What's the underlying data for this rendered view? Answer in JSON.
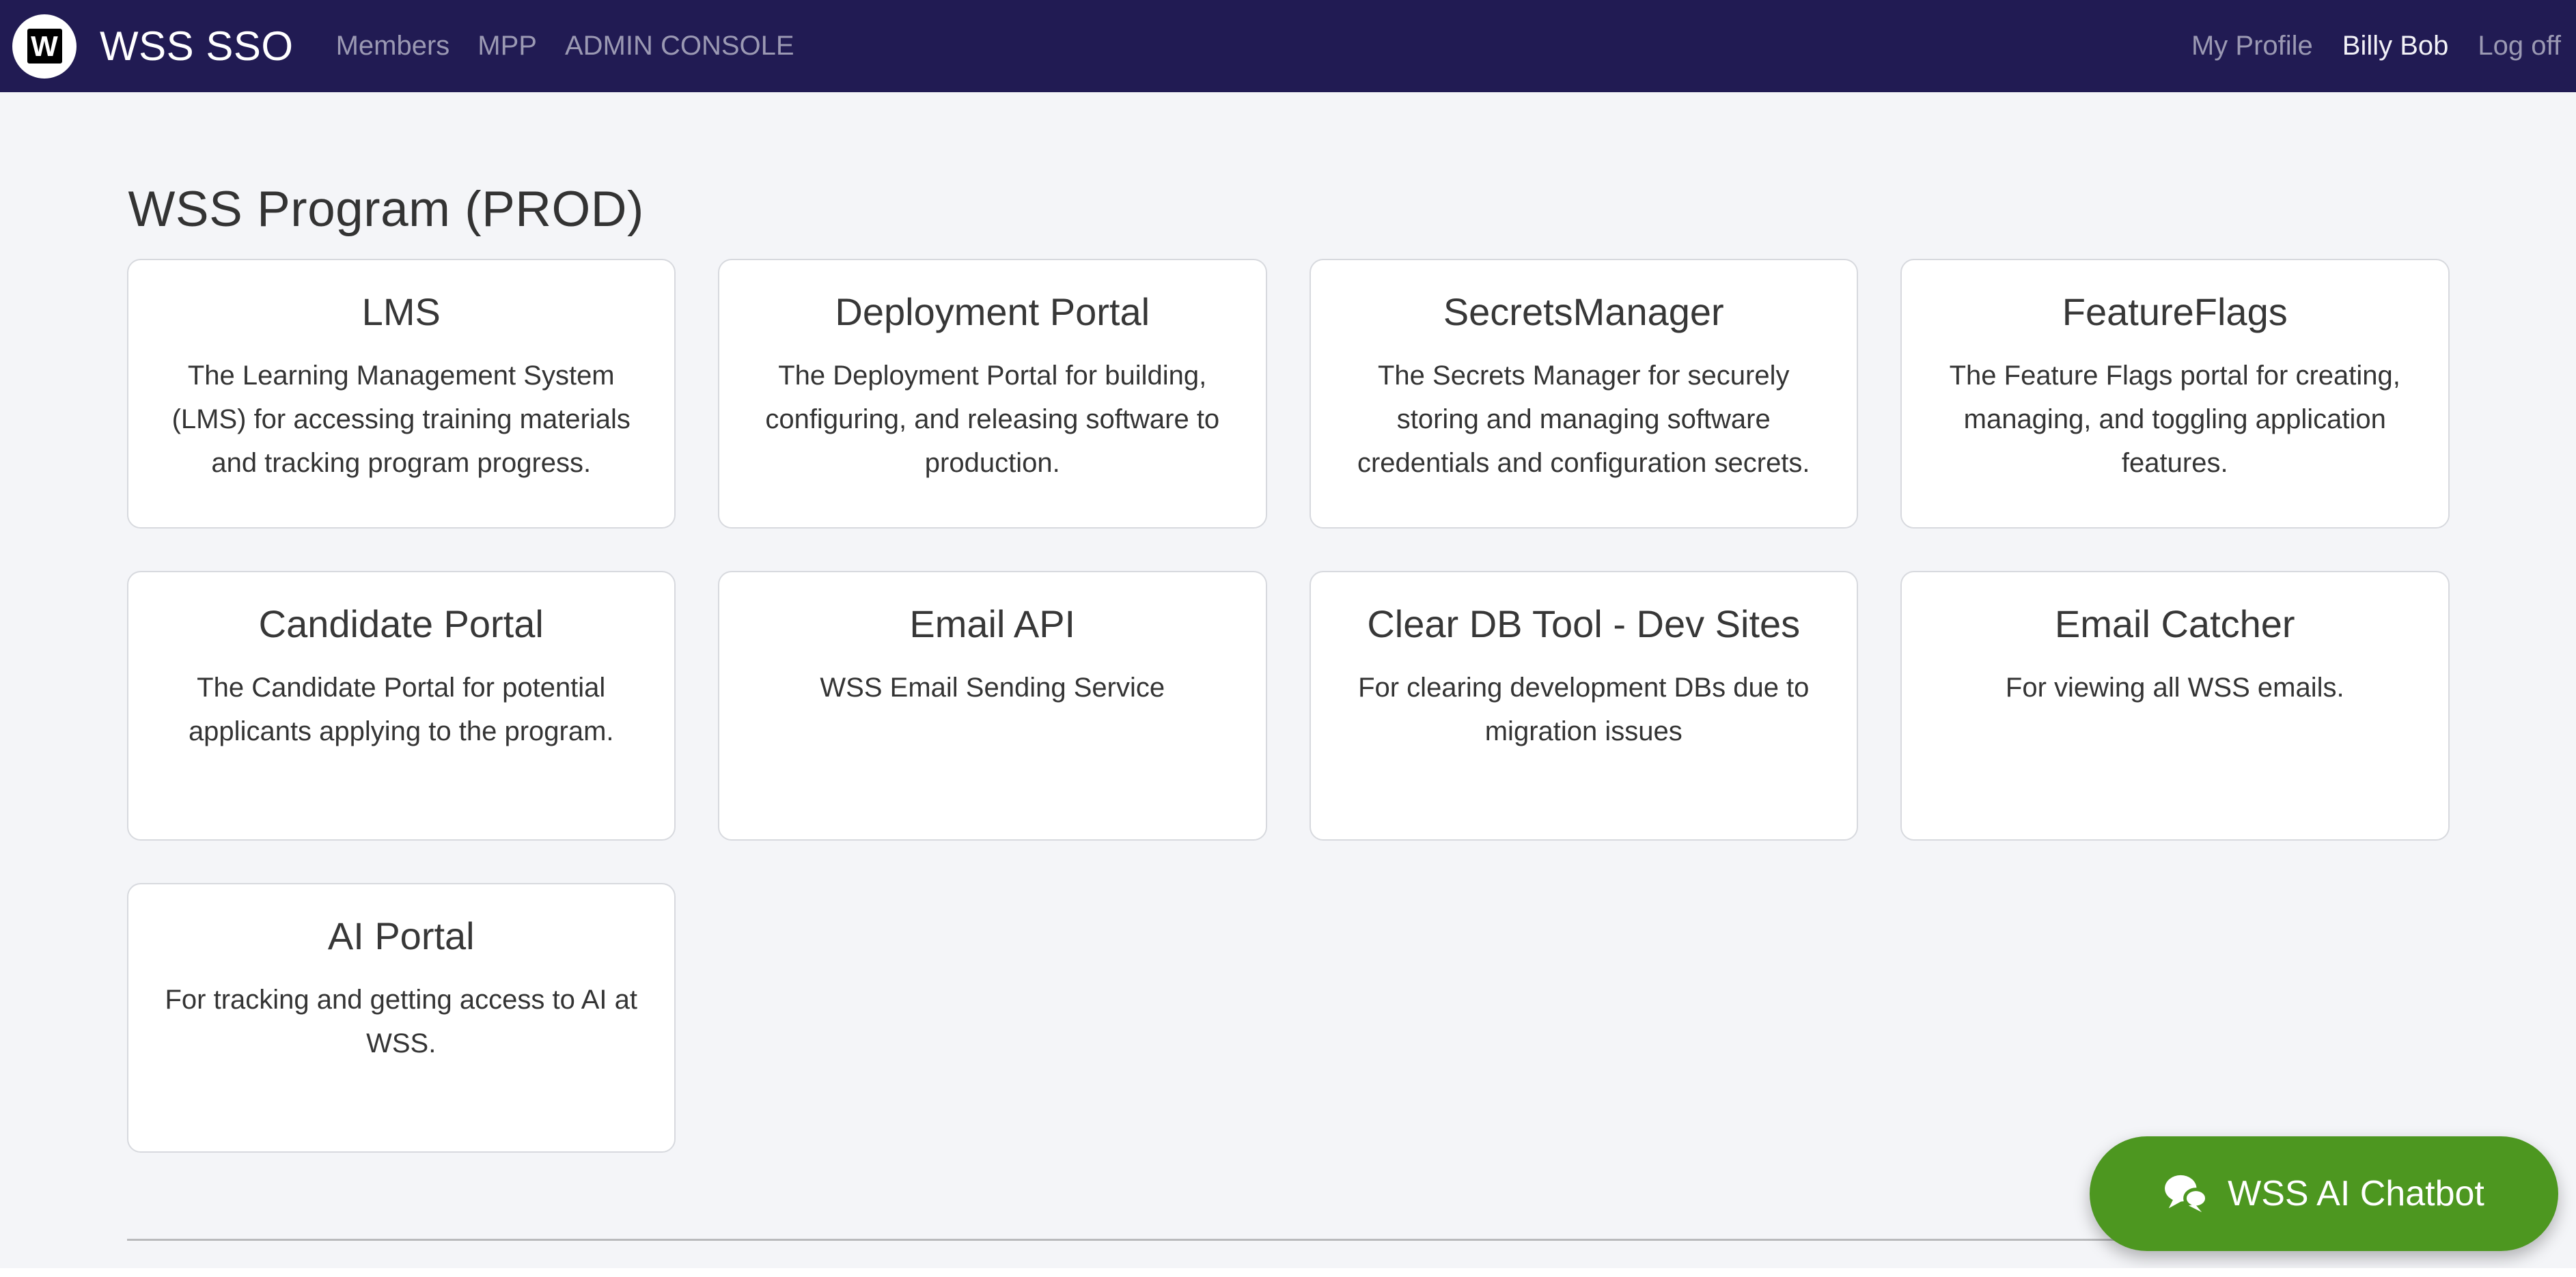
{
  "navbar": {
    "logo_letter": "W",
    "brand": "WSS SSO",
    "left_links": [
      {
        "label": "Members"
      },
      {
        "label": "MPP"
      },
      {
        "label": "ADMIN CONSOLE"
      }
    ],
    "right_links": [
      {
        "label": "My Profile",
        "highlighted": false
      },
      {
        "label": "Billy Bob",
        "highlighted": true
      },
      {
        "label": "Log off",
        "highlighted": false
      }
    ]
  },
  "page": {
    "title": "WSS Program (PROD)"
  },
  "cards": [
    {
      "title": "LMS",
      "description": "The Learning Management System (LMS) for accessing training materials and tracking program progress."
    },
    {
      "title": "Deployment Portal",
      "description": "The Deployment Portal for building, configuring, and releasing software to production."
    },
    {
      "title": "SecretsManager",
      "description": "The Secrets Manager for securely storing and managing software credentials and configuration secrets."
    },
    {
      "title": "FeatureFlags",
      "description": "The Feature Flags portal for creating, managing, and toggling application features."
    },
    {
      "title": "Candidate Portal",
      "description": "The Candidate Portal for potential applicants applying to the program."
    },
    {
      "title": "Email API",
      "description": "WSS Email Sending Service"
    },
    {
      "title": "Clear DB Tool - Dev Sites",
      "description": "For clearing development DBs due to migration issues"
    },
    {
      "title": "Email Catcher",
      "description": "For viewing all WSS emails."
    },
    {
      "title": "AI Portal",
      "description": "For tracking and getting access to AI at WSS."
    }
  ],
  "chatbot": {
    "label": "WSS AI Chatbot",
    "icon": "comments-icon"
  },
  "colors": {
    "navbar_bg": "#211b53",
    "nav_link": "#9b99b3",
    "nav_link_active": "#f2f1f7",
    "page_bg": "#f4f5f8",
    "card_border": "#d7d9de",
    "text_dark": "#333333",
    "chatbot_green": "#4d9720",
    "divider": "#b9babc"
  }
}
